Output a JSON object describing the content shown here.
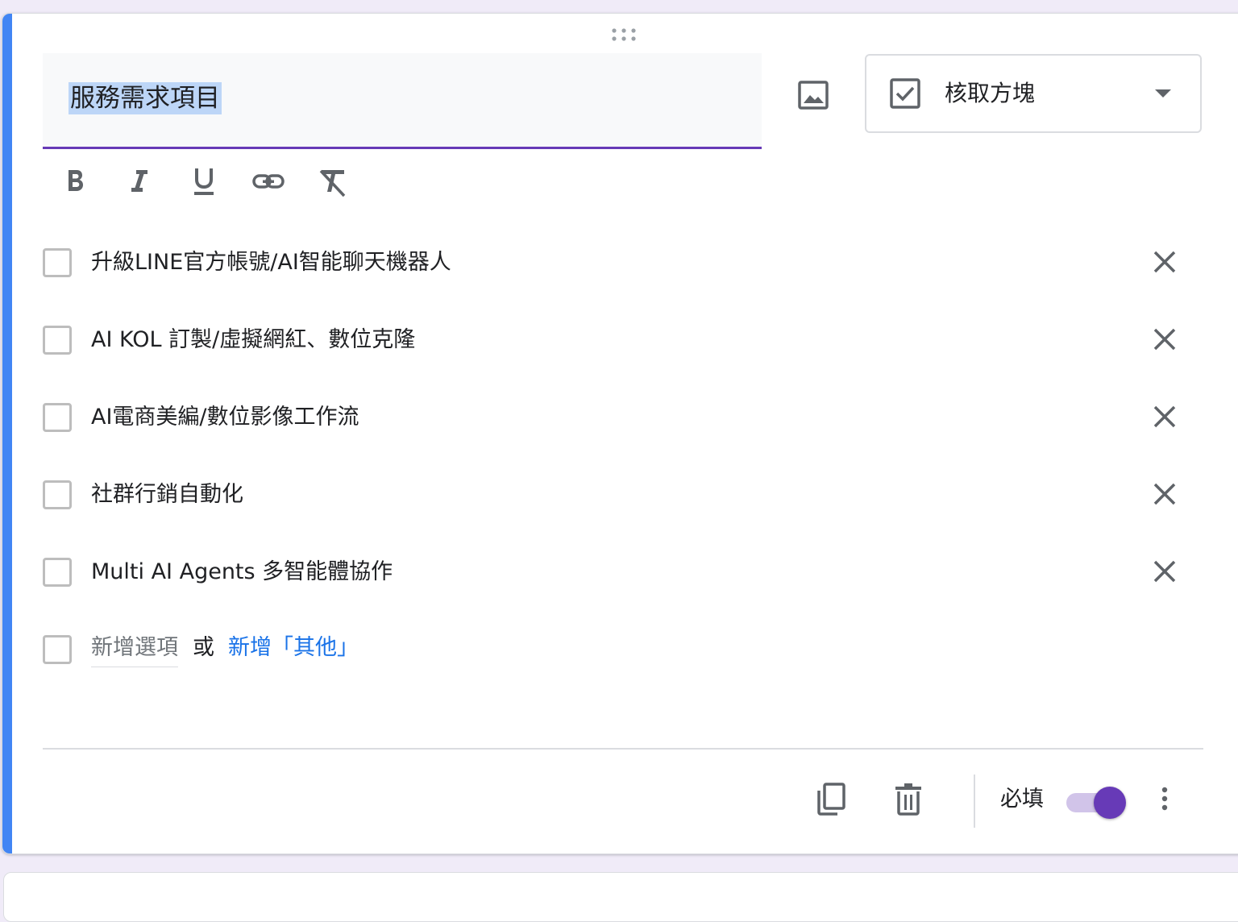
{
  "question": {
    "title": "服務需求項目",
    "type_label": "核取方塊"
  },
  "format_toolbar": {
    "items": [
      "bold",
      "italic",
      "underline",
      "link",
      "clear-formatting"
    ]
  },
  "options": [
    {
      "label": "升級LINE官方帳號/AI智能聊天機器人"
    },
    {
      "label": "AI KOL 訂製/虛擬網紅、數位克隆"
    },
    {
      "label": "AI電商美編/數位影像工作流"
    },
    {
      "label": "社群行銷自動化"
    },
    {
      "label": "Multi AI Agents 多智能體協作"
    }
  ],
  "add_option": {
    "placeholder": "新增選項",
    "or_text": "或",
    "add_other_label": "新增「其他」"
  },
  "footer": {
    "required_label": "必填",
    "required_on": true
  },
  "colors": {
    "accent_blue": "#4285f4",
    "accent_purple": "#673ab7",
    "link_blue": "#1a73e8",
    "background": "#f0ebf8"
  }
}
